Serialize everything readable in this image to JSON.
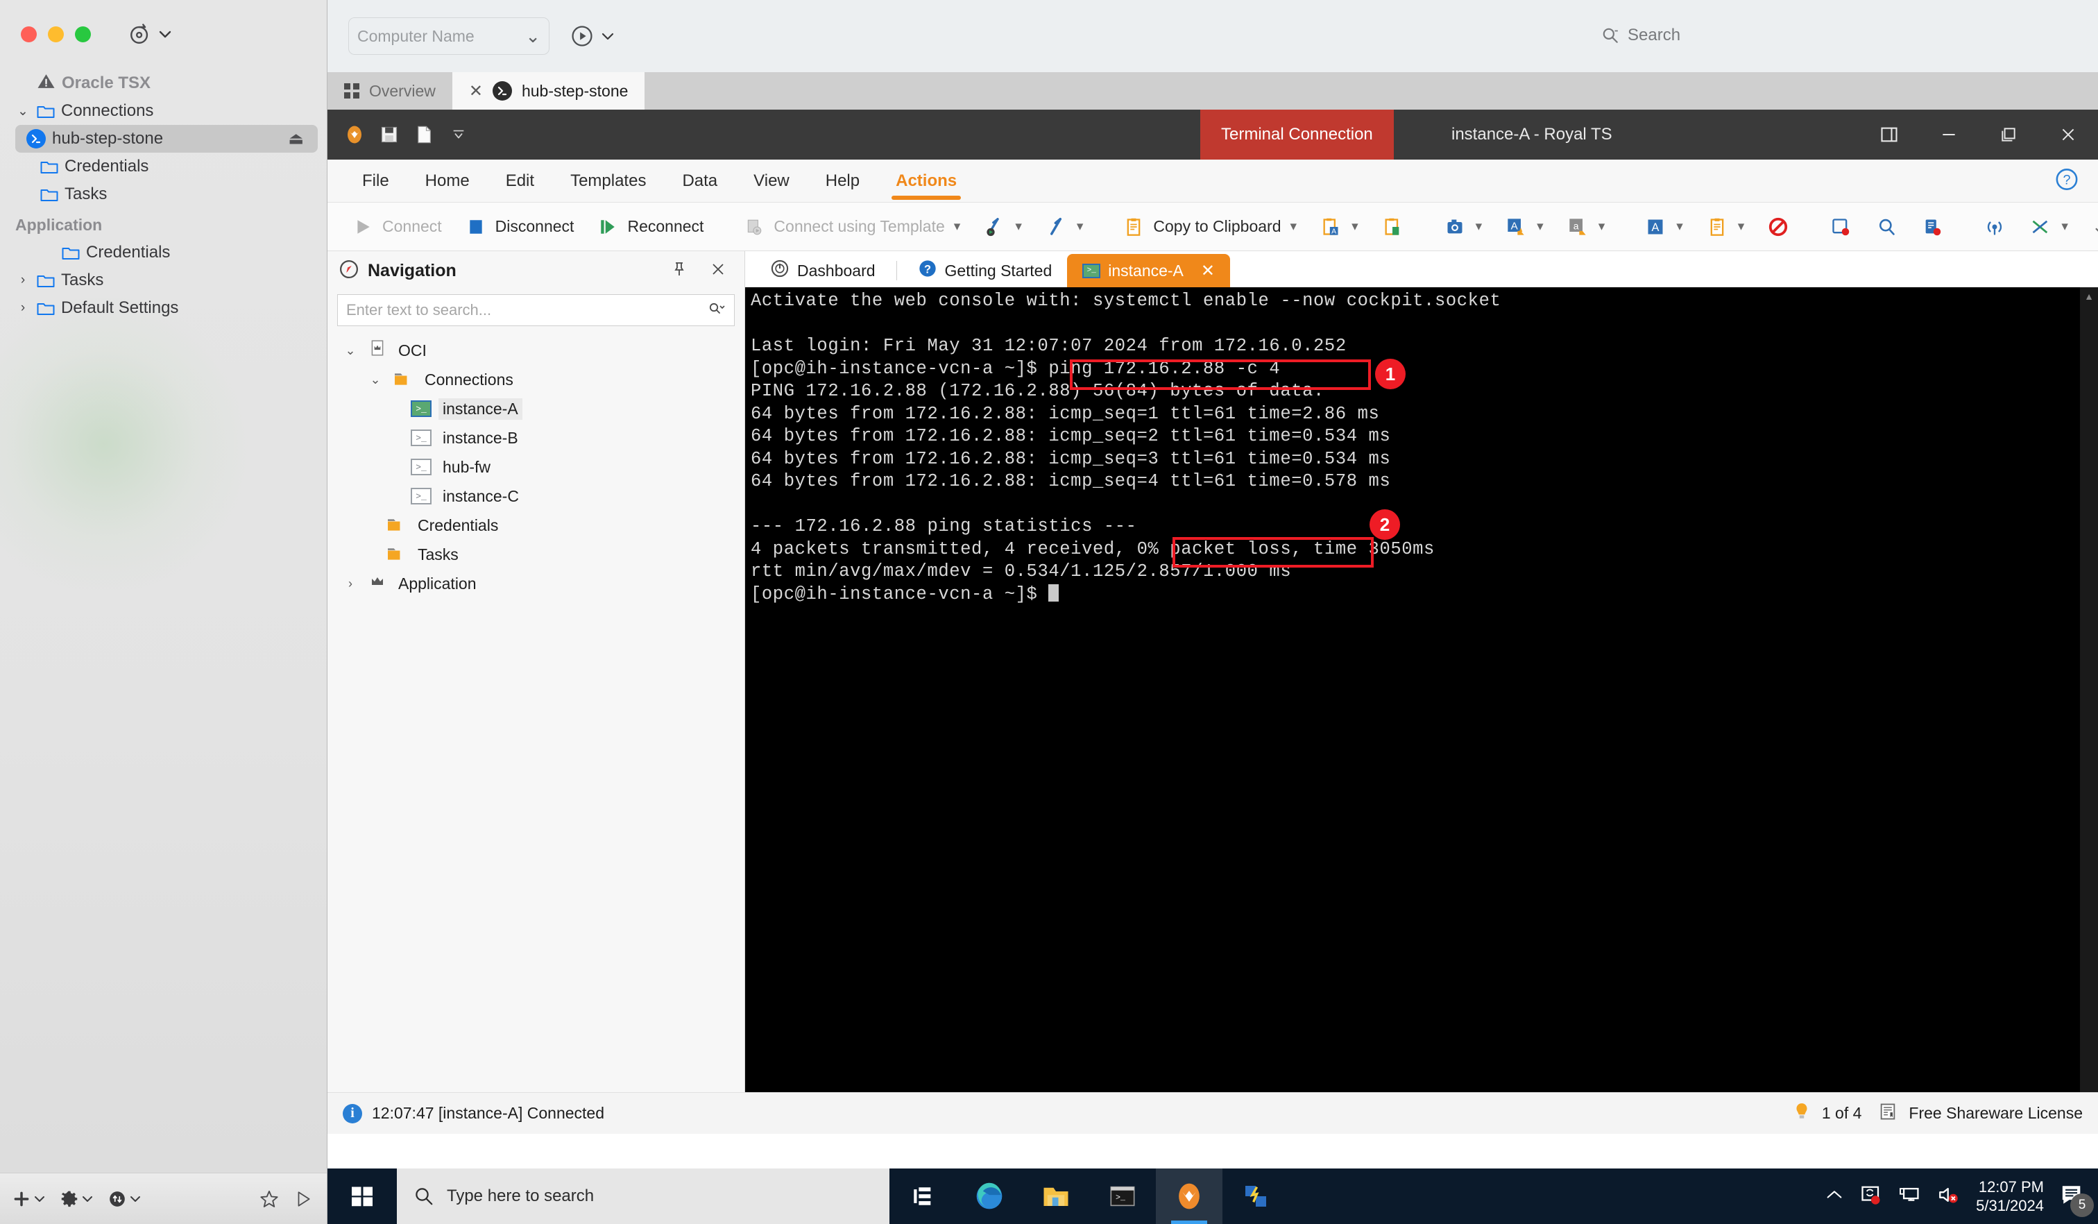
{
  "mac_window": {
    "refresh_icon": "refresh-circle-icon",
    "sidebar": {
      "root_label": "Oracle TSX",
      "root_icon": "warning-triangle-icon",
      "items": [
        {
          "label": "Connections",
          "icon": "folder-icon",
          "twisty": "⌄",
          "indent": 1,
          "selected": false
        },
        {
          "label": "hub-step-stone",
          "icon": "vscode-remote-icon",
          "twisty": "",
          "indent": 2,
          "selected": true,
          "eject": "⏏"
        },
        {
          "label": "Credentials",
          "icon": "folder-icon",
          "twisty": "",
          "indent": 2,
          "selected": false
        },
        {
          "label": "Tasks",
          "icon": "folder-icon",
          "twisty": "",
          "indent": 2,
          "selected": false
        }
      ],
      "section_label": "Application",
      "app_items": [
        {
          "label": "Credentials",
          "icon": "folder-icon",
          "twisty": "",
          "indent": 2
        },
        {
          "label": "Tasks",
          "icon": "folder-icon",
          "twisty": "›",
          "indent": 2
        },
        {
          "label": "Default Settings",
          "icon": "folder-icon",
          "twisty": "›",
          "indent": 2
        }
      ]
    },
    "bottom_bar": {
      "add_icon": "plus-icon",
      "settings_icon": "gear-icon",
      "transfer_icon": "transfer-circle-icon",
      "favorite_icon": "star-icon",
      "run_icon": "play-triangle-icon"
    }
  },
  "rdp_header": {
    "computer_name_placeholder": "Computer Name",
    "computer_name_value": "",
    "dropdown_caret": "⌄",
    "connect_icon": "play-circle-icon",
    "search_placeholder": "Search",
    "search_icon": "search-icon"
  },
  "outer_tabs": [
    {
      "label": "Overview",
      "icon": "grid-icon",
      "active": false,
      "closable": false
    },
    {
      "label": "hub-step-stone",
      "icon": "vscode-remote-icon",
      "active": true,
      "closable": true,
      "close_glyph": "✕"
    }
  ],
  "royal_ts": {
    "titlebar": {
      "context_label": "Terminal Connection",
      "document_title": "instance-A - Royal TS",
      "quick_access": [
        "royal-ts-logo-icon",
        "save-icon",
        "new-document-icon",
        "customize-quick-access-icon"
      ],
      "window_buttons": [
        "restore-layout-icon",
        "minimize-icon",
        "maximize-icon",
        "close-icon"
      ]
    },
    "menu": {
      "items": [
        "File",
        "Home",
        "Edit",
        "Templates",
        "Data",
        "View",
        "Help",
        "Actions"
      ],
      "active": "Actions",
      "help_icon": "help-question-icon"
    },
    "ribbon": {
      "connect_label": "Connect",
      "disconnect_label": "Disconnect",
      "reconnect_label": "Reconnect",
      "connect_template_label": "Connect using Template",
      "copy_clipboard_label": "Copy to Clipboard",
      "icons": [
        "key-connect-icon",
        "key-icon",
        "clipboard-icon",
        "clipboard-paste-text-icon",
        "clipboard-paste-file-icon",
        "screenshot-icon",
        "font-increase-icon",
        "font-decrease-icon",
        "font-icon",
        "log-icon",
        "stop-record-icon",
        "send-key-icon",
        "find-icon",
        "send-to-device-icon",
        "broadcast-icon",
        "shuffle-icon"
      ],
      "overflow_caret": "⌄",
      "expand_caret": "⌄"
    },
    "navigation": {
      "title": "Navigation",
      "compass_icon": "compass-icon",
      "pin_icon": "pin-icon",
      "close_icon": "close-icon",
      "search_placeholder": "Enter text to search...",
      "search_icon": "search-dropdown-icon",
      "tree": [
        {
          "label": "OCI",
          "icon": "crown-doc-icon",
          "twisty": "⌄",
          "indent": 0,
          "selected": false
        },
        {
          "label": "Connections",
          "icon": "orange-folder-icon",
          "twisty": "⌄",
          "indent": 1,
          "selected": false
        },
        {
          "label": "instance-A",
          "icon": "terminal-active-icon",
          "twisty": "",
          "indent": 2,
          "selected": true
        },
        {
          "label": "instance-B",
          "icon": "terminal-icon",
          "twisty": "",
          "indent": 2,
          "selected": false
        },
        {
          "label": "hub-fw",
          "icon": "terminal-icon",
          "twisty": "",
          "indent": 2,
          "selected": false
        },
        {
          "label": "instance-C",
          "icon": "terminal-icon",
          "twisty": "",
          "indent": 2,
          "selected": false
        },
        {
          "label": "Credentials",
          "icon": "orange-folder-icon",
          "twisty": "",
          "indent": 3,
          "selected": false
        },
        {
          "label": "Tasks",
          "icon": "orange-folder-icon",
          "twisty": "",
          "indent": 3,
          "selected": false
        },
        {
          "label": "Application",
          "icon": "crown-icon",
          "twisty": "›",
          "indent": 0,
          "selected": false
        }
      ]
    },
    "content_tabs": [
      {
        "label": "Dashboard",
        "icon": "dashboard-icon",
        "active": false,
        "closable": false
      },
      {
        "label": "Getting Started",
        "icon": "help-question-icon",
        "active": false,
        "closable": false
      },
      {
        "label": "instance-A",
        "icon": "terminal-active-icon",
        "active": true,
        "closable": true,
        "close_glyph": "✕"
      }
    ],
    "terminal": {
      "lines": [
        "Activate the web console with: systemctl enable --now cockpit.socket",
        "",
        "Last login: Fri May 31 12:07:07 2024 from 172.16.0.252",
        "[opc@ih-instance-vcn-a ~]$ ping 172.16.2.88 -c 4",
        "PING 172.16.2.88 (172.16.2.88) 56(84) bytes of data.",
        "64 bytes from 172.16.2.88: icmp_seq=1 ttl=61 time=2.86 ms",
        "64 bytes from 172.16.2.88: icmp_seq=2 ttl=61 time=0.534 ms",
        "64 bytes from 172.16.2.88: icmp_seq=3 ttl=61 time=0.534 ms",
        "64 bytes from 172.16.2.88: icmp_seq=4 ttl=61 time=0.578 ms",
        "",
        "--- 172.16.2.88 ping statistics ---",
        "4 packets transmitted, 4 received, 0% packet loss, time 3050ms",
        "rtt min/avg/max/mdev = 0.534/1.125/2.857/1.000 ms",
        "[opc@ih-instance-vcn-a ~]$ "
      ],
      "annotations": [
        {
          "number": "1",
          "text": "ping 172.16.2.88 -c 4"
        },
        {
          "number": "2",
          "text": "0% packet loss,"
        }
      ]
    },
    "status_bar": {
      "info_icon": "info-icon",
      "message": "12:07:47 [instance-A] Connected",
      "tip_icon": "lightbulb-icon",
      "tip_count": "1 of 4",
      "license_icon": "certificate-icon",
      "license": "Free Shareware License"
    }
  },
  "taskbar": {
    "start_icon": "windows-start-icon",
    "search_icon": "search-icon",
    "search_placeholder": "Type here to search",
    "apps": [
      {
        "icon": "task-view-icon",
        "active": false
      },
      {
        "icon": "edge-browser-icon",
        "active": false
      },
      {
        "icon": "file-explorer-icon",
        "active": false
      },
      {
        "icon": "terminal-app-icon",
        "active": false
      },
      {
        "icon": "royal-ts-app-icon",
        "active": true
      },
      {
        "icon": "remote-desktop-icon",
        "active": false
      }
    ],
    "tray": {
      "chevron_icon": "show-hidden-icons-icon",
      "onedrive_icon": "sync-error-icon",
      "network_icon": "network-icon",
      "volume_icon": "volume-muted-icon",
      "time": "12:07 PM",
      "date": "5/31/2024",
      "notification_icon": "notifications-icon",
      "notification_count": "5"
    }
  }
}
